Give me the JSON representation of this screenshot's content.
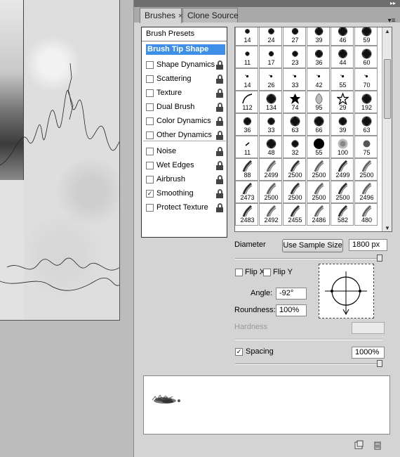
{
  "panel": {
    "tabs": [
      {
        "label": "Brushes",
        "close": "×",
        "active": true
      },
      {
        "label": "Clone Source",
        "active": false
      }
    ],
    "collapse_icon": "double-chevron-right-icon",
    "menu_icon": "panel-menu-icon"
  },
  "options": {
    "presets_label": "Brush Presets",
    "selected_label": "Brush Tip Shape",
    "items": [
      {
        "label": "Shape Dynamics",
        "checked": false
      },
      {
        "label": "Scattering",
        "checked": false
      },
      {
        "label": "Texture",
        "checked": false
      },
      {
        "label": "Dual Brush",
        "checked": false
      },
      {
        "label": "Color Dynamics",
        "checked": false
      },
      {
        "label": "Other Dynamics",
        "checked": false
      },
      {
        "label": "Noise",
        "checked": false
      },
      {
        "label": "Wet Edges",
        "checked": false
      },
      {
        "label": "Airbrush",
        "checked": false
      },
      {
        "label": "Smoothing",
        "checked": true
      },
      {
        "label": "Protect Texture",
        "checked": false
      }
    ],
    "check_mark": "✓"
  },
  "brush_grid": {
    "rows": [
      [
        "14",
        "24",
        "27",
        "39",
        "46",
        "59"
      ],
      [
        "11",
        "17",
        "23",
        "36",
        "44",
        "60"
      ],
      [
        "14",
        "26",
        "33",
        "42",
        "55",
        "70"
      ],
      [
        "112",
        "134",
        "74",
        "95",
        "29",
        "192"
      ],
      [
        "36",
        "33",
        "63",
        "66",
        "39",
        "63"
      ],
      [
        "11",
        "48",
        "32",
        "55",
        "100",
        "75"
      ],
      [
        "88",
        "2499",
        "2500",
        "2500",
        "2499",
        "2500"
      ],
      [
        "2473",
        "2500",
        "2500",
        "2500",
        "2500",
        "2496"
      ],
      [
        "2483",
        "2492",
        "2455",
        "2486",
        "582",
        "480"
      ]
    ]
  },
  "controls": {
    "diameter_label": "Diameter",
    "sample_button": "Use Sample Size",
    "diameter_value": "1800 px",
    "diameter_fraction": 1.0,
    "flip_x_label": "Flip X",
    "flip_y_label": "Flip Y",
    "angle_label": "Angle:",
    "angle_value": "-92°",
    "roundness_label": "Roundness:",
    "roundness_value": "100%",
    "hardness_label": "Hardness",
    "spacing_label": "Spacing",
    "spacing_checked": true,
    "spacing_value": "1000%",
    "spacing_fraction": 1.0
  },
  "bottom_icons": [
    "new-preset-icon",
    "trash-icon"
  ]
}
